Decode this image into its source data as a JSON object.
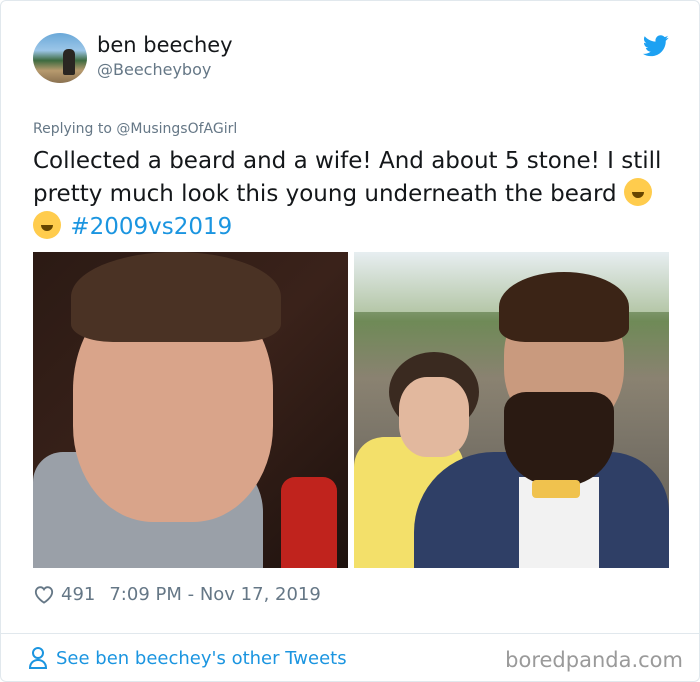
{
  "user": {
    "name": "ben beechey",
    "handle": "@Beecheyboy"
  },
  "reply": {
    "text": "Replying to @MusingsOfAGirl"
  },
  "tweet": {
    "text": "Collected a beard and a wife! And about 5 stone! I still pretty much look this young underneath the beard",
    "emojis": [
      "rolling-on-floor-laughing",
      "rolling-on-floor-laughing"
    ],
    "hashtag": "#2009vs2019"
  },
  "stats": {
    "likes": "491",
    "timestamp": "7:09 PM - Nov 17, 2019"
  },
  "footer": {
    "see_more": "See ben beechey's other Tweets",
    "watermark": "boredpanda.com"
  },
  "colors": {
    "text": "#14171a",
    "muted": "#657786",
    "accent": "#1b95e0",
    "twitter_blue": "#1da1f2",
    "border": "#e1e8ed"
  },
  "icons": {
    "brand": "twitter-bird-icon",
    "like": "heart-icon",
    "profile": "person-icon"
  }
}
